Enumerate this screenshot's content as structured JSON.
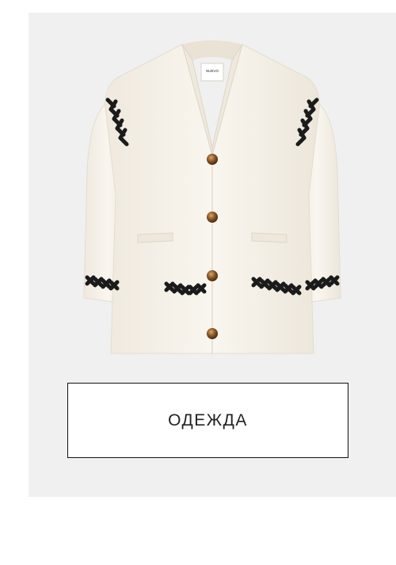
{
  "category": {
    "button_label": "ОДЕЖДА",
    "image_icon": "cardigan-image",
    "brand_label": "NUEVO"
  },
  "colors": {
    "card_background": "#f0f0f0",
    "garment": "#f7f3ea",
    "trim": "#1b1b1b",
    "buttons": "#a06a33",
    "button_border": "#111111"
  }
}
